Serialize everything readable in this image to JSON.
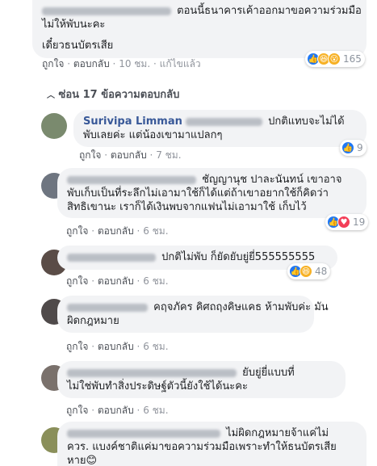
{
  "top": {
    "text1": "ตอนนี้ธนาคารเค้าออกมาขอความร่วมมือ",
    "text2": "ไม่ให้พับนะคะ",
    "text3": "เดี๋ยวธนบัตรเสีย",
    "like": "ถูกใจ",
    "reply": "ตอบกลับ",
    "time": "10 ชม.",
    "edited": "แก้ไขแล้ว",
    "count": "165"
  },
  "replies_toggle": "ซ่อน 17 ข้อความตอบกลับ",
  "replies": [
    {
      "name": "Surivipa Limman",
      "text1": "ปกติแทบจะไม่ได้",
      "text2": "พับเลยค่ะ แต่น้องเขามาแปลกๆ",
      "like": "ถูกใจ",
      "reply": "ตอบกลับ",
      "time": "7 ชม.",
      "count": "9"
    },
    {
      "text1": "ชัญญานุช ปาละนันทน์ เขาอาจ",
      "text2": "พับเก็บเป็นที่ระลึกไม่เอามาใช้ก็ได้แต่ถ้าเขาอยากใช้ก็คิดว่า",
      "text3": "สิทธิเขานะ เราก็ได้เงินพบจากแฟนไม่เอามาใช้ เก็บไว้",
      "like": "ถูกใจ",
      "reply": "ตอบกลับ",
      "time": "6 ชม.",
      "count": "19"
    },
    {
      "text1": "ปกติไม่พับ ก็ยัดยับยู่ยี่555555555",
      "like": "ถูกใจ",
      "reply": "ตอบกลับ",
      "time": "6 ชม.",
      "count": "48"
    },
    {
      "text1": "คฤจภัคร คิศถฤงคิษแคธ ห้ามพับค่ะ มัน",
      "text2": "ผิดกฎหมาย",
      "like": "ถูกใจ",
      "reply": "ตอบกลับ",
      "time": "6 ชม."
    },
    {
      "text1": "ยับยู่ยี่แบบที่",
      "text2": "ไม่ใช่พับทำสิ่งประดิษฐ์ตัวนี้ยังใช้ได้นะคะ",
      "like": "ถูกใจ",
      "reply": "ตอบกลับ",
      "time": "6 ชม."
    },
    {
      "text1": "ไม่ผิดกฎหมายจ้าแค่ไม่",
      "text2": "ควร. แบงค์ชาติแค่มาขอความร่วมมือเพราะทำให้ธนบัตรเสีย",
      "text3": "หาย😊"
    }
  ],
  "colors": {
    "like": "#2078f4",
    "love": "#f33e58",
    "haha": "#f7b125",
    "link": "#385898"
  }
}
